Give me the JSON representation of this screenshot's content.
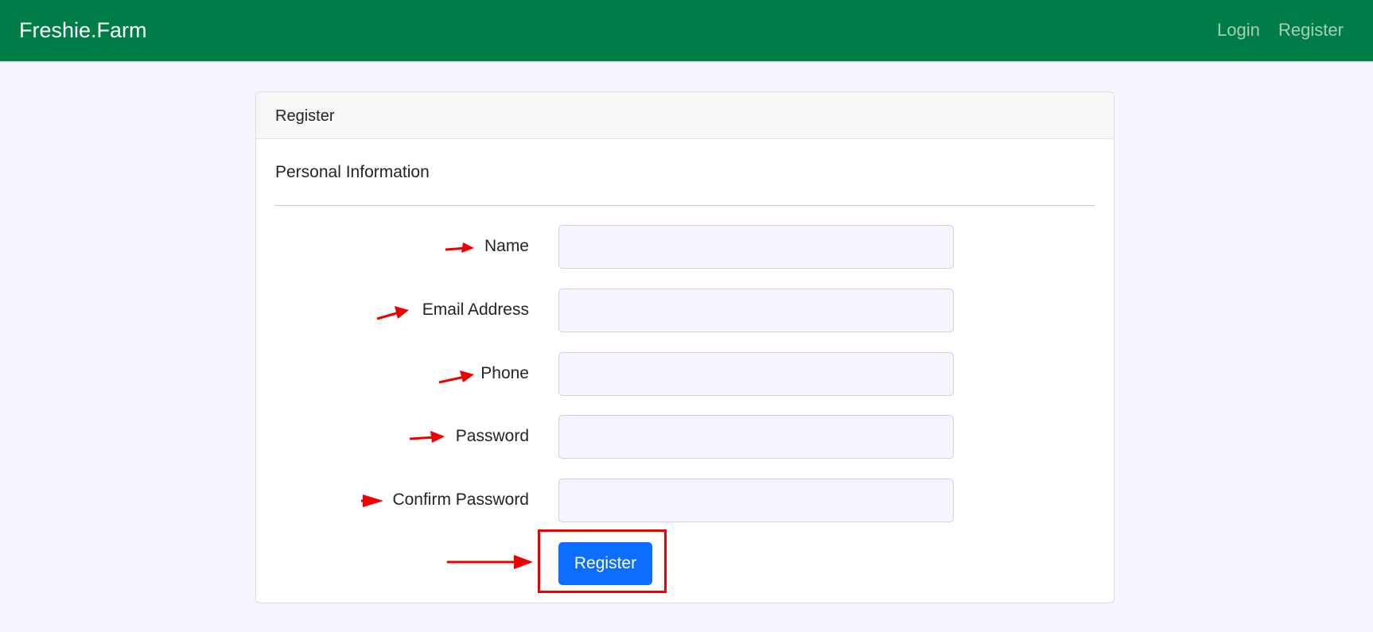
{
  "navbar": {
    "brand": "Freshie.Farm",
    "links": [
      {
        "label": "Login"
      },
      {
        "label": "Register"
      }
    ]
  },
  "card": {
    "header": "Register",
    "section_title": "Personal Information",
    "fields": [
      {
        "label": "Name",
        "value": ""
      },
      {
        "label": "Email Address",
        "value": ""
      },
      {
        "label": "Phone",
        "value": ""
      },
      {
        "label": "Password",
        "value": ""
      },
      {
        "label": "Confirm Password",
        "value": ""
      }
    ],
    "submit_label": "Register"
  },
  "colors": {
    "navbar": "#007d47",
    "primary": "#0d6efd",
    "annotation": "#ef0000"
  }
}
